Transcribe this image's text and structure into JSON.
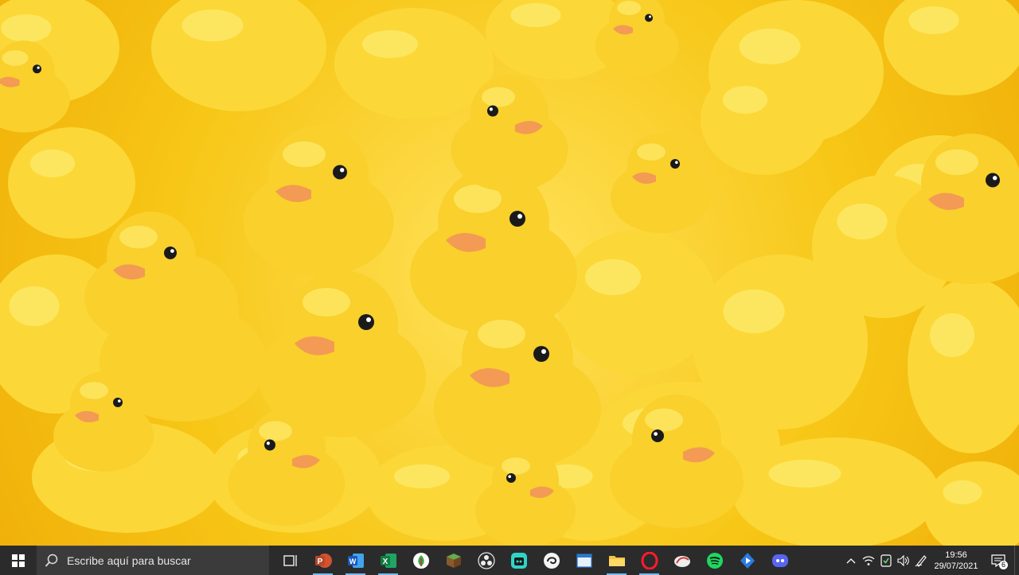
{
  "wallpaper": {
    "subject": "rubber ducks"
  },
  "taskbar": {
    "search_placeholder": "Escribe aquí para buscar",
    "apps": [
      {
        "name": "task-view"
      },
      {
        "name": "powerpoint",
        "running": true
      },
      {
        "name": "word",
        "running": true
      },
      {
        "name": "excel",
        "running": true
      },
      {
        "name": "app-green"
      },
      {
        "name": "minecraft"
      },
      {
        "name": "obs"
      },
      {
        "name": "app-teal"
      },
      {
        "name": "app-white"
      },
      {
        "name": "app-window"
      },
      {
        "name": "file-explorer",
        "running": true
      },
      {
        "name": "opera",
        "running": true
      },
      {
        "name": "app-cloud"
      },
      {
        "name": "spotify"
      },
      {
        "name": "app-blue"
      },
      {
        "name": "discord"
      }
    ],
    "clock_time": "19:56",
    "clock_date": "29/07/2021",
    "notification_count": "6"
  },
  "colors": {
    "taskbar_bg": "#2b2b2b",
    "duck": "#f9d02c",
    "beak": "#f39a54"
  }
}
